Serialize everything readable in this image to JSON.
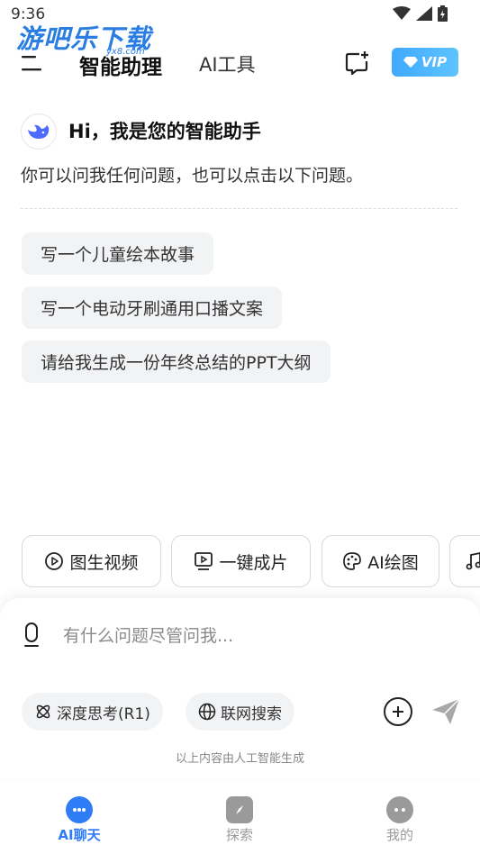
{
  "status_bar": {
    "time": "9:36"
  },
  "watermark": {
    "text": "游吧乐下载",
    "sub": "yx8.com"
  },
  "header": {
    "tabs": [
      {
        "label": "智能助理"
      },
      {
        "label": "AI工具"
      }
    ],
    "vip_label": "VIP"
  },
  "greeting": {
    "title": "Hi，我是您的智能助手",
    "subtitle": "你可以问我任何问题，也可以点击以下问题。"
  },
  "suggestions": [
    {
      "label": "写一个儿童绘本故事"
    },
    {
      "label": "写一个电动牙刷通用口播文案"
    },
    {
      "label": "请给我生成一份年终总结的PPT大纲"
    }
  ],
  "quick_tools": [
    {
      "label": "图生视频",
      "icon": "play-circle-icon"
    },
    {
      "label": "一键成片",
      "icon": "video-screen-icon"
    },
    {
      "label": "AI绘图",
      "icon": "palette-icon"
    },
    {
      "label": "",
      "icon": "music-note-icon"
    }
  ],
  "composer": {
    "placeholder": "有什么问题尽管问我...",
    "chips": [
      {
        "label": "深度思考(R1)",
        "icon": "atom-icon"
      },
      {
        "label": "联网搜索",
        "icon": "globe-icon"
      }
    ],
    "disclaimer": "以上内容由人工智能生成"
  },
  "bottom_nav": [
    {
      "label": "AI聊天",
      "icon": "chat-bubble-icon",
      "active": true,
      "color": "#2f7cf6"
    },
    {
      "label": "探索",
      "icon": "compass-icon",
      "active": false,
      "color": "#9a9a9a"
    },
    {
      "label": "我的",
      "icon": "profile-icon",
      "active": false,
      "color": "#9a9a9a"
    }
  ]
}
